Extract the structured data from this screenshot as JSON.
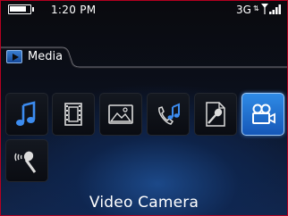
{
  "status_bar": {
    "time": "1:20 PM",
    "network": "3G",
    "battery_level": 0.85
  },
  "header": {
    "title": "Media",
    "icon": "media-play-icon"
  },
  "apps": [
    {
      "name": "Music",
      "icon": "music-note-icon"
    },
    {
      "name": "Videos",
      "icon": "film-strip-icon"
    },
    {
      "name": "Pictures",
      "icon": "picture-icon"
    },
    {
      "name": "Ring Tones",
      "icon": "phone-music-icon"
    },
    {
      "name": "Voice Notes",
      "icon": "voice-notes-icon"
    },
    {
      "name": "Video Camera",
      "icon": "video-camera-icon",
      "selected": true
    },
    {
      "name": "Voice Notes Recorder",
      "icon": "voice-recorder-icon"
    }
  ],
  "selected_caption": "Video Camera",
  "colors": {
    "accent": "#2f8be6",
    "frame": "#b40020"
  }
}
